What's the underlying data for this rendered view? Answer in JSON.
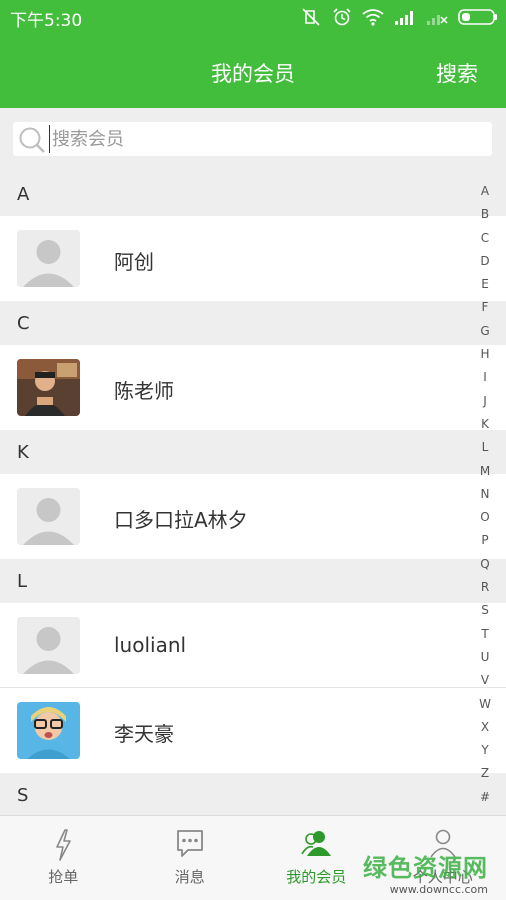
{
  "status": {
    "time": "下午5:30"
  },
  "header": {
    "title": "我的会员",
    "search_label": "搜索"
  },
  "search": {
    "placeholder": "搜索会员",
    "value": ""
  },
  "sections": [
    {
      "letter": "A",
      "members": [
        {
          "name": "阿创",
          "avatar": "default-avatar"
        }
      ]
    },
    {
      "letter": "C",
      "members": [
        {
          "name": "陈老师",
          "avatar": "photo-avatar"
        }
      ]
    },
    {
      "letter": "K",
      "members": [
        {
          "name": "口多口拉A林夕",
          "avatar": "default-avatar"
        }
      ]
    },
    {
      "letter": "L",
      "members": [
        {
          "name": "luolianl",
          "avatar": "default-avatar"
        },
        {
          "name": "李天豪",
          "avatar": "photo-avatar"
        }
      ]
    },
    {
      "letter": "S",
      "members": []
    }
  ],
  "index_letters": [
    "A",
    "B",
    "C",
    "D",
    "E",
    "F",
    "G",
    "H",
    "I",
    "J",
    "K",
    "L",
    "M",
    "N",
    "O",
    "P",
    "Q",
    "R",
    "S",
    "T",
    "U",
    "V",
    "W",
    "X",
    "Y",
    "Z",
    "#"
  ],
  "tabs": [
    {
      "label": "抢单",
      "icon": "lightning-icon",
      "active": false
    },
    {
      "label": "消息",
      "icon": "chat-bubble-icon",
      "active": false
    },
    {
      "label": "我的会员",
      "icon": "members-icon",
      "active": true
    },
    {
      "label": "个人中心",
      "icon": "person-icon",
      "active": false
    }
  ],
  "watermark": {
    "text": "绿色资源网",
    "url": "www.downcc.com"
  },
  "colors": {
    "brand_green": "#43bd3c",
    "active_tab": "#2e9a2c",
    "section_bg": "#eeeeee"
  }
}
